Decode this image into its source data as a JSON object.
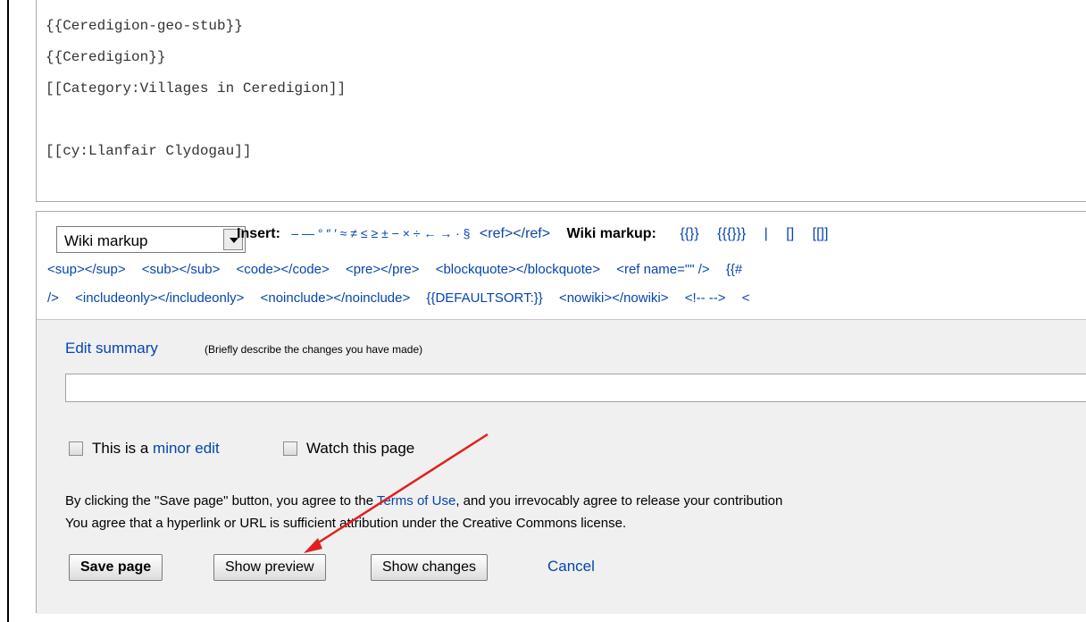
{
  "wikitext": {
    "lines": [
      "{{Ceredigion-geo-stub}}",
      "{{Ceredigion}}",
      "[[Category:Villages in Ceredigion]]",
      "",
      "[[cy:Llanfair Clydogau]]"
    ]
  },
  "charinsert": {
    "select_value": "Wiki markup",
    "insert_label": "Insert:",
    "insert_chars": "– — ° ″ ′ ≈ ≠ ≤ ≥ ± − × ÷ ← → · §",
    "ref_tag": "<ref></ref>",
    "wiki_markup_label": "Wiki markup:",
    "row1_items": [
      "{{}}",
      "{{{}}}",
      "|",
      "[]",
      "[[]]"
    ],
    "row2_items": [
      "<sup></sup>",
      "<sub></sub>",
      "<code></code>",
      "<pre></pre>",
      "<blockquote></blockquote>",
      "<ref name=\"\" />",
      "{{#"
    ],
    "row3_items": [
      "/>",
      "<includeonly></includeonly>",
      "<noinclude></noinclude>",
      "{{DEFAULTSORT:}}",
      "<nowiki></nowiki>",
      "<!-- -->",
      "<"
    ]
  },
  "summary": {
    "label": "Edit summary",
    "hint": "(Briefly describe the changes you have made)",
    "value": ""
  },
  "options": {
    "minor_prefix": "This is a",
    "minor_link": "minor edit",
    "watch_label": "Watch this page"
  },
  "notice": {
    "line1_prefix": "By clicking the \"Save page\" button, you agree to the",
    "line1_link": "Terms of Use",
    "line1_suffix": ", and you irrevocably agree to release your contribution",
    "line2": "You agree that a hyperlink or URL is sufficient attribution under the Creative Commons license."
  },
  "buttons": {
    "save": "Save page",
    "preview": "Show preview",
    "changes": "Show changes",
    "cancel": "Cancel"
  },
  "colors": {
    "link": "#0645ad",
    "annotation_arrow": "#e02020"
  }
}
